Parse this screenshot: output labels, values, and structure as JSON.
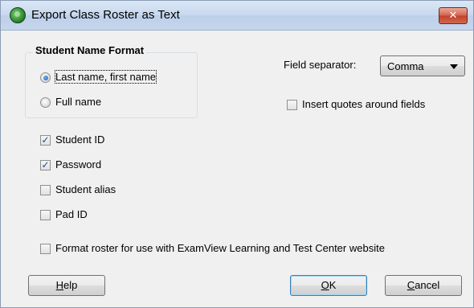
{
  "window": {
    "title": "Export Class Roster as Text"
  },
  "name_format": {
    "title": "Student Name Format",
    "options": [
      {
        "label": "Last name, first name",
        "checked": true
      },
      {
        "label": "Full name",
        "checked": false
      }
    ]
  },
  "field_separator": {
    "label": "Field separator:",
    "value": "Comma"
  },
  "insert_quotes": {
    "label": "Insert quotes around fields",
    "checked": false
  },
  "fields": [
    {
      "label": "Student ID",
      "checked": true
    },
    {
      "label": "Password",
      "checked": true
    },
    {
      "label": "Student alias",
      "checked": false
    },
    {
      "label": "Pad ID",
      "checked": false
    }
  ],
  "format_website": {
    "label": "Format roster for use with ExamView Learning and Test Center website",
    "checked": false
  },
  "buttons": {
    "help": {
      "mnemonic": "H",
      "rest": "elp"
    },
    "ok": {
      "mnemonic": "O",
      "rest": "K"
    },
    "cancel": {
      "mnemonic": "C",
      "rest": "ancel"
    }
  },
  "icons": {
    "close": "close-icon",
    "app": "app-icon"
  }
}
